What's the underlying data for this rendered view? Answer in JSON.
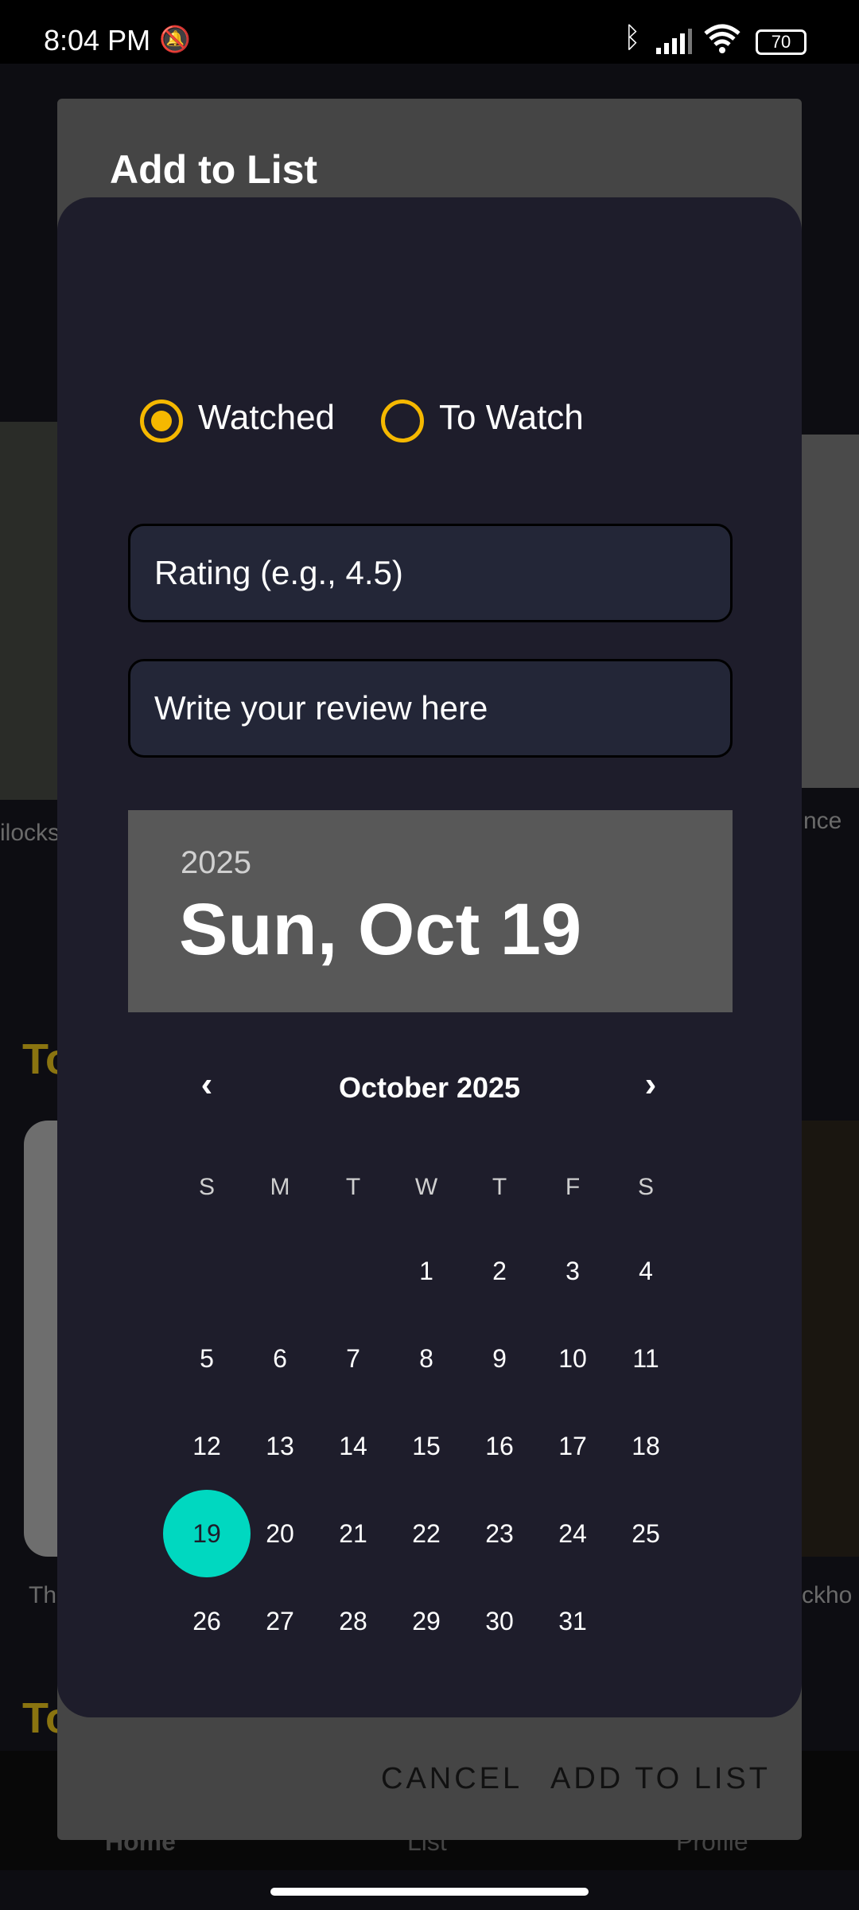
{
  "status_bar": {
    "time": "8:04 PM",
    "battery": "70",
    "icons": [
      "bell-off-icon",
      "bluetooth-icon",
      "signal-icon",
      "wifi-icon",
      "battery-icon"
    ]
  },
  "background": {
    "left_caption": "ilocks",
    "right_caption": "nce",
    "section_1": "To",
    "section_2": "To",
    "lower_left_caption": "Th",
    "lower_right_caption": "ckho",
    "nav": [
      "Home",
      "List",
      "Profile"
    ]
  },
  "dialog": {
    "title": "Add to List",
    "radios": [
      {
        "label": "Watched",
        "selected": true
      },
      {
        "label": "To Watch",
        "selected": false
      }
    ],
    "rating_placeholder": "Rating (e.g., 4.5)",
    "review_placeholder": "Write your review here",
    "date_picker": {
      "year": "2025",
      "selected_date": "Sun, Oct 19",
      "month_label": "October 2025",
      "weekdays": [
        "S",
        "M",
        "T",
        "W",
        "T",
        "F",
        "S"
      ],
      "weeks": [
        [
          "",
          "",
          "",
          "1",
          "2",
          "3",
          "4"
        ],
        [
          "5",
          "6",
          "7",
          "8",
          "9",
          "10",
          "11"
        ],
        [
          "12",
          "13",
          "14",
          "15",
          "16",
          "17",
          "18"
        ],
        [
          "19",
          "20",
          "21",
          "22",
          "23",
          "24",
          "25"
        ],
        [
          "26",
          "27",
          "28",
          "29",
          "30",
          "31",
          ""
        ]
      ],
      "selected_day": "19",
      "accent": "#00d8c0"
    },
    "cancel_label": "CANCEL",
    "confirm_label": "ADD TO LIST",
    "radio_color": "#f5b800"
  }
}
